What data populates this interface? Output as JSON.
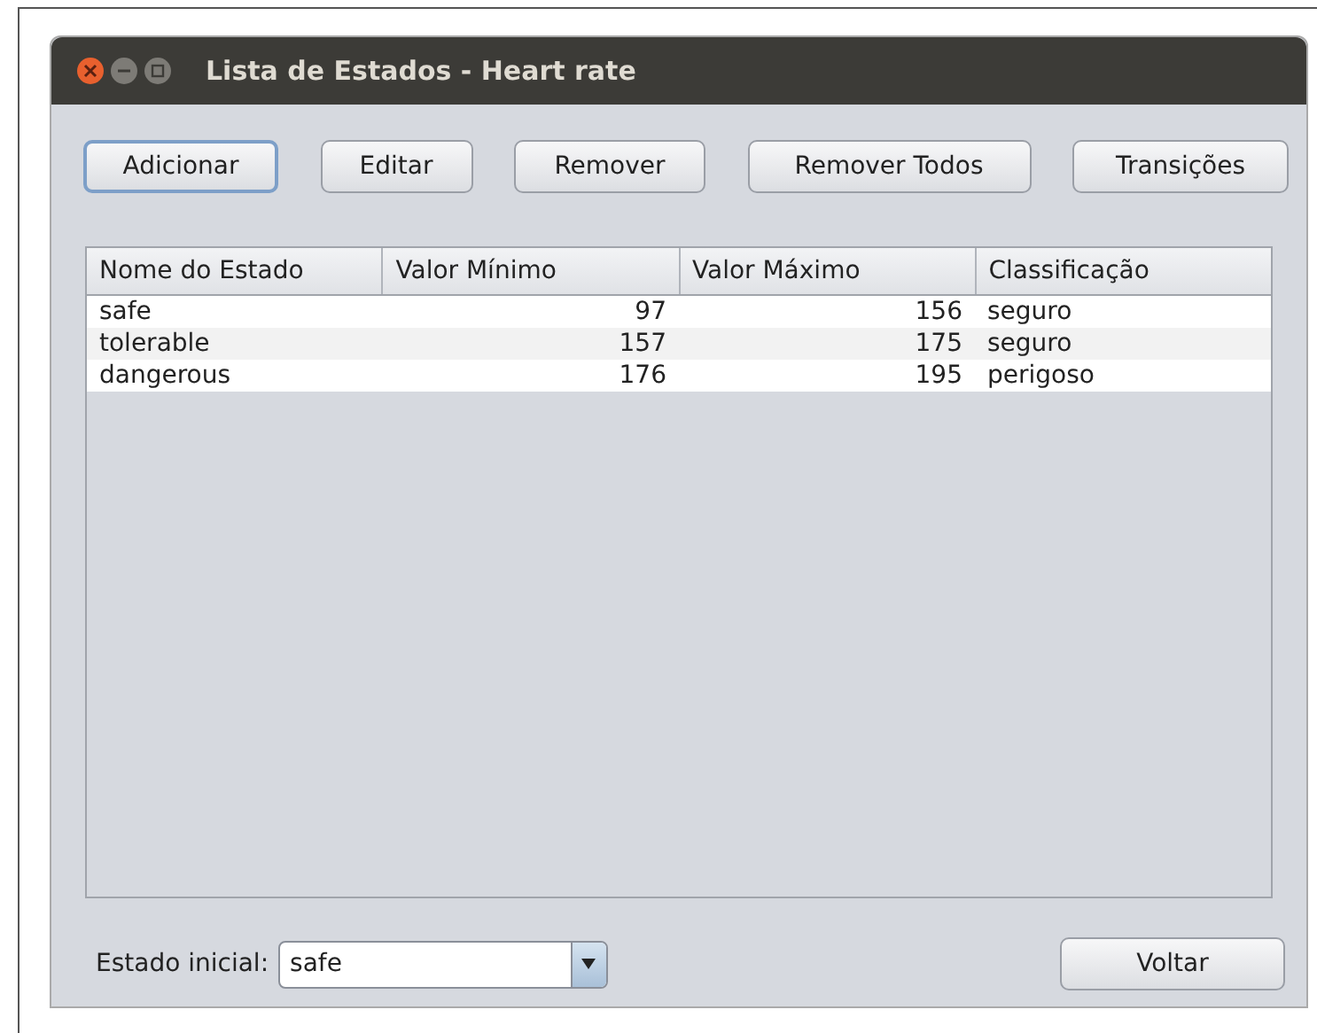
{
  "window": {
    "title": "Lista de Estados - Heart rate"
  },
  "buttons": [
    {
      "label": "Adicionar",
      "focused": true
    },
    {
      "label": "Editar",
      "focused": false
    },
    {
      "label": "Remover",
      "focused": false
    },
    {
      "label": "Remover Todos",
      "focused": false
    },
    {
      "label": "Transições",
      "focused": false
    }
  ],
  "table": {
    "columns": [
      "Nome do Estado",
      "Valor Mínimo",
      "Valor Máximo",
      "Classificação"
    ],
    "rows": [
      [
        "safe",
        "97",
        "156",
        "seguro"
      ],
      [
        "tolerable",
        "157",
        "175",
        "seguro"
      ],
      [
        "dangerous",
        "176",
        "195",
        "perigoso"
      ]
    ]
  },
  "initial_state": {
    "label": "Estado inicial:",
    "value": "safe"
  },
  "back_button": {
    "label": "Voltar"
  }
}
